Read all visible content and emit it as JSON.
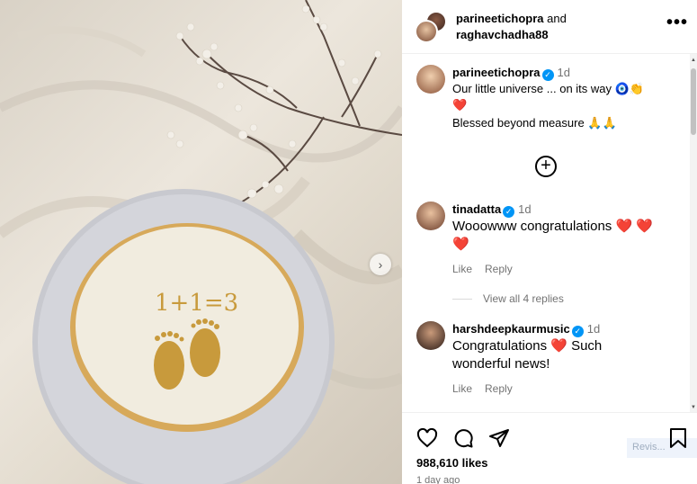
{
  "header": {
    "user1": "parineetichopra",
    "conjunction": " and",
    "user2": "raghavchadha88",
    "more": "•••"
  },
  "caption": {
    "username": "parineetichopra",
    "time": "1d",
    "line1": "Our little universe ... on its way 🧿👏",
    "line2": "❤️",
    "line3": "Blessed beyond measure 🙏🙏"
  },
  "comments": [
    {
      "username": "tinadatta",
      "time": "1d",
      "text1": "Wooowww congratulations ❤️ ❤️",
      "text2": "❤️",
      "like": "Like",
      "reply": "Reply"
    },
    {
      "username": "harshdeepkaurmusic",
      "time": "1d",
      "text1": "Congratulations ❤️ Such",
      "text2": "wonderful news!",
      "like": "Like",
      "reply": "Reply"
    }
  ],
  "view_replies": "View all 4 replies",
  "photo": {
    "cake_text": "1+1=3"
  },
  "footer": {
    "likes": "988,610 likes",
    "ago": "1 day ago",
    "overlay": "Revis..."
  },
  "colors": {
    "verified": "#0095f6",
    "heart": "#e0163a",
    "muted": "#737373"
  }
}
